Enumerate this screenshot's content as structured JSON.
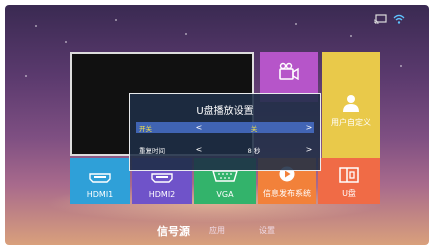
{
  "tiles": {
    "user_defined": "用户自定义",
    "hdmi1": "HDMI1",
    "hdmi2": "HDMI2",
    "vga": "VGA",
    "info_release": "信息发布系统",
    "udisk": "U盘"
  },
  "dialog": {
    "title": "U盘播放设置",
    "rows": [
      {
        "name": "开关",
        "value": "关",
        "selected": true
      },
      {
        "name": "重复时间",
        "value": "8 秒",
        "selected": false
      }
    ]
  },
  "nav": {
    "items": [
      "信号源",
      "应用",
      "设置"
    ],
    "active": "信号源"
  },
  "icons": [
    "cast-icon",
    "wifi-icon",
    "camera-icon",
    "user-icon",
    "hdmi-icon",
    "vga-icon",
    "play-icon",
    "udisk-icon"
  ],
  "colors": {
    "accent_yellow": "#f3e24a",
    "tile_movie": "#b655c9",
    "tile_user": "#e9c94a",
    "tile_hdmi1": "#2fa0d8",
    "tile_hdmi2": "#6f53c9",
    "tile_vga": "#33b36b",
    "tile_info": "#f2813a",
    "tile_udisk": "#f06b46"
  }
}
